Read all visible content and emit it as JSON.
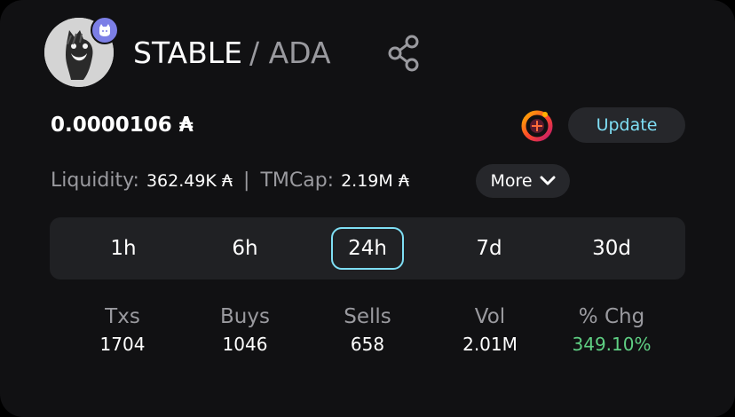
{
  "header": {
    "base_symbol": "STABLE",
    "quote_symbol": "/ ADA",
    "avatar_icon": "horse-avatar",
    "badge_icon": "cat-badge-icon",
    "share_icon": "share-icon"
  },
  "price": {
    "value": "0.0000106 ₳",
    "dex_icon": "dex-logo-icon",
    "update_label": "Update"
  },
  "liquidity": {
    "liquidity_label": "Liquidity:",
    "liquidity_value": "362.49K ₳",
    "separator": "|",
    "tmcap_label": "TMCap:",
    "tmcap_value": "2.19M ₳",
    "more_label": "More"
  },
  "timeframes": {
    "tabs": [
      "1h",
      "6h",
      "24h",
      "7d",
      "30d"
    ],
    "selected": "24h"
  },
  "stats": [
    {
      "label": "Txs",
      "value": "1704"
    },
    {
      "label": "Buys",
      "value": "1046"
    },
    {
      "label": "Sells",
      "value": "658"
    },
    {
      "label": "Vol",
      "value": "2.01M"
    },
    {
      "label": "% Chg",
      "value": "349.10%"
    }
  ],
  "colors": {
    "accent": "#7fdff5",
    "positive": "#5fcf83",
    "muted": "#9a9a9f",
    "card": "#111113",
    "panel": "#202124"
  }
}
